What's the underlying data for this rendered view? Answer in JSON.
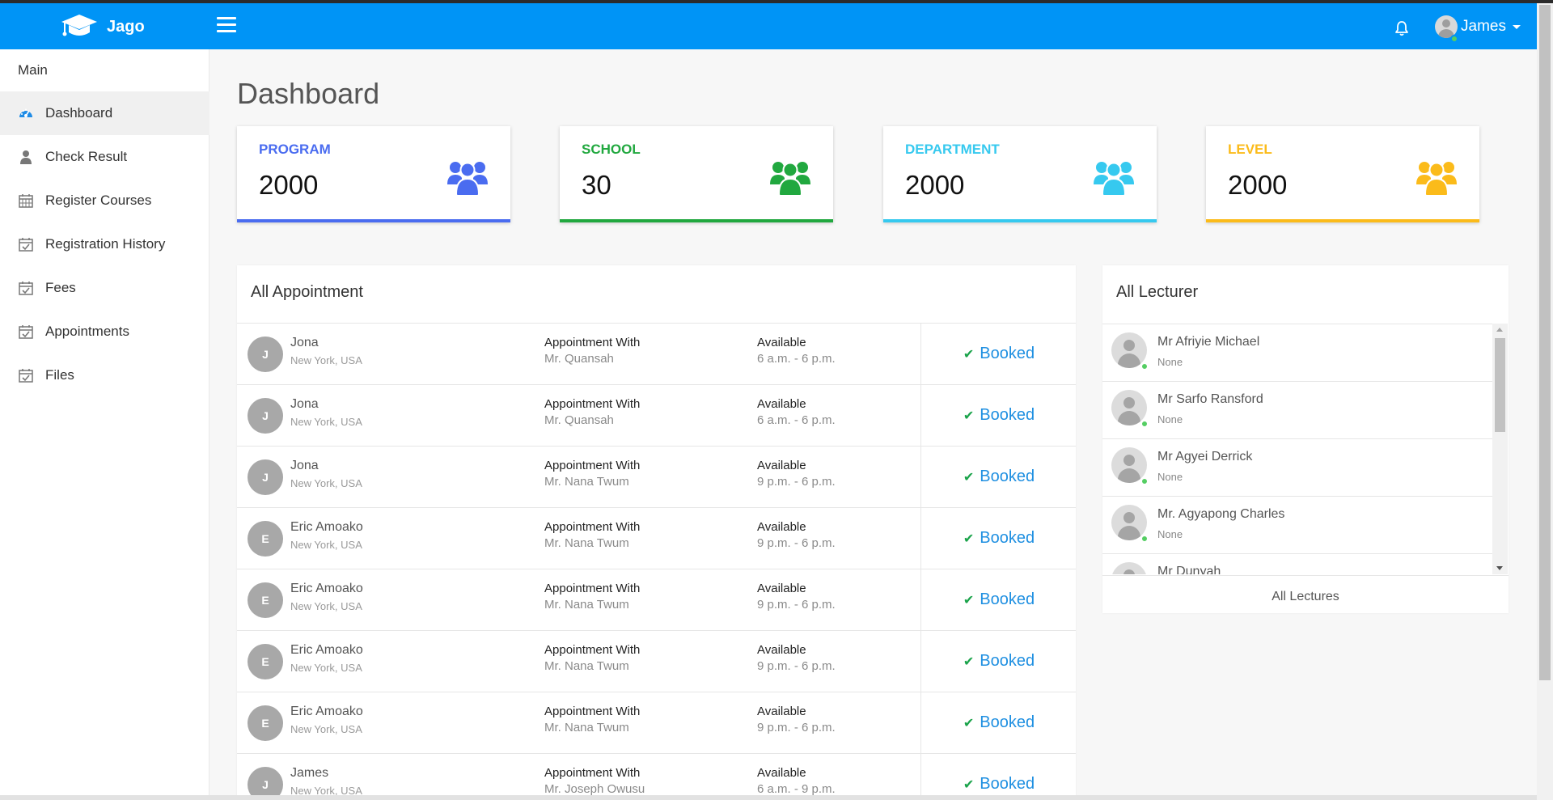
{
  "header": {
    "brand_name": "Jago",
    "user_name": "James"
  },
  "colors": {
    "header_bg": "#0094f6",
    "program": "#4a6cf0",
    "school": "#21a83f",
    "department": "#36c9ef",
    "level": "#fbbb1a",
    "status_booked": "#1e8fe1",
    "online": "#55ce63"
  },
  "sidebar": {
    "title": "Main",
    "items": [
      {
        "label": "Dashboard",
        "icon": "dashboard-icon",
        "active": true
      },
      {
        "label": "Check Result",
        "icon": "user-icon"
      },
      {
        "label": "Register Courses",
        "icon": "calendar-icon"
      },
      {
        "label": "Registration History",
        "icon": "calendar-check-icon"
      },
      {
        "label": "Fees",
        "icon": "calendar-check-icon"
      },
      {
        "label": "Appointments",
        "icon": "calendar-check-icon"
      },
      {
        "label": "Files",
        "icon": "calendar-check-icon"
      }
    ]
  },
  "page": {
    "title": "Dashboard"
  },
  "stats": [
    {
      "label": "PROGRAM",
      "value": "2000",
      "icon": "users-icon"
    },
    {
      "label": "SCHOOL",
      "value": "30",
      "icon": "users-icon"
    },
    {
      "label": "DEPARTMENT",
      "value": "2000",
      "icon": "users-icon"
    },
    {
      "label": "LEVEL",
      "value": "2000",
      "icon": "users-icon"
    }
  ],
  "appointments": {
    "title": "All Appointment",
    "rows": [
      {
        "initial": "J",
        "name": "Jona",
        "location": "New York, USA",
        "with_label": "Appointment With",
        "lecturer": "Mr. Quansah",
        "avail_label": "Available",
        "time": "6 a.m. - 6 p.m.",
        "status": "Booked"
      },
      {
        "initial": "J",
        "name": "Jona",
        "location": "New York, USA",
        "with_label": "Appointment With",
        "lecturer": "Mr. Quansah",
        "avail_label": "Available",
        "time": "6 a.m. - 6 p.m.",
        "status": "Booked"
      },
      {
        "initial": "J",
        "name": "Jona",
        "location": "New York, USA",
        "with_label": "Appointment With",
        "lecturer": "Mr. Nana Twum",
        "avail_label": "Available",
        "time": "9 p.m. - 6 p.m.",
        "status": "Booked"
      },
      {
        "initial": "E",
        "name": "Eric Amoako",
        "location": "New York, USA",
        "with_label": "Appointment With",
        "lecturer": "Mr. Nana Twum",
        "avail_label": "Available",
        "time": "9 p.m. - 6 p.m.",
        "status": "Booked"
      },
      {
        "initial": "E",
        "name": "Eric Amoako",
        "location": "New York, USA",
        "with_label": "Appointment With",
        "lecturer": "Mr. Nana Twum",
        "avail_label": "Available",
        "time": "9 p.m. - 6 p.m.",
        "status": "Booked"
      },
      {
        "initial": "E",
        "name": "Eric Amoako",
        "location": "New York, USA",
        "with_label": "Appointment With",
        "lecturer": "Mr. Nana Twum",
        "avail_label": "Available",
        "time": "9 p.m. - 6 p.m.",
        "status": "Booked"
      },
      {
        "initial": "E",
        "name": "Eric Amoako",
        "location": "New York, USA",
        "with_label": "Appointment With",
        "lecturer": "Mr. Nana Twum",
        "avail_label": "Available",
        "time": "9 p.m. - 6 p.m.",
        "status": "Booked"
      },
      {
        "initial": "J",
        "name": "James",
        "location": "New York, USA",
        "with_label": "Appointment With",
        "lecturer": "Mr. Joseph Owusu",
        "avail_label": "Available",
        "time": "6 a.m. - 9 p.m.",
        "status": "Booked"
      }
    ]
  },
  "lecturers": {
    "title": "All Lecturer",
    "footer_label": "All Lectures",
    "items": [
      {
        "name": "Mr Afriyie Michael",
        "sub": "None"
      },
      {
        "name": "Mr Sarfo Ransford",
        "sub": "None"
      },
      {
        "name": "Mr Agyei Derrick",
        "sub": "None"
      },
      {
        "name": "Mr. Agyapong Charles",
        "sub": "None"
      },
      {
        "name": "Mr Dunyah",
        "sub": ""
      }
    ]
  }
}
